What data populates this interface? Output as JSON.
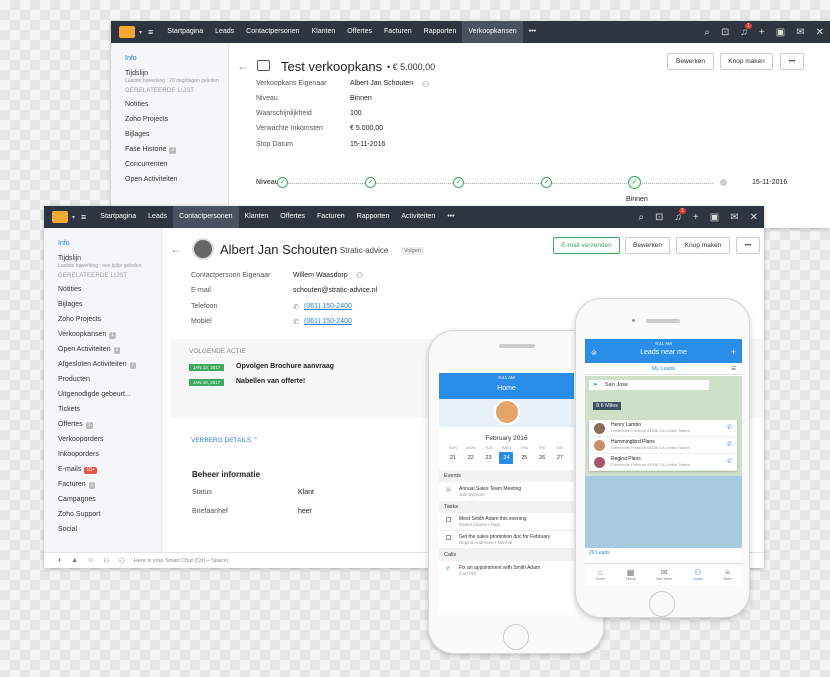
{
  "back_window": {
    "nav": [
      "Startpagina",
      "Leads",
      "Contactpersonen",
      "Klanten",
      "Offertes",
      "Facturen",
      "Rapporten",
      "Verkoopkansen"
    ],
    "active": "Verkoopkansen",
    "more": "•••",
    "sidebar": {
      "info": "Info",
      "tijdslijn": "Tijdslijn",
      "tijdslijn_sub": "Laatste bijwerking : 20 dag/dagen geleden",
      "related_header": "GERELATEERDE LIJST",
      "items": [
        {
          "label": "Notities",
          "count": ""
        },
        {
          "label": "Zoho Projects",
          "count": ""
        },
        {
          "label": "Bijlages",
          "count": ""
        },
        {
          "label": "Fase Historie",
          "count": "3"
        },
        {
          "label": "Concurrenten",
          "count": ""
        },
        {
          "label": "Open Activiteiten",
          "count": ""
        }
      ]
    },
    "title": "Test verkoopkans",
    "amount": "• € 5.000,00",
    "buttons": {
      "edit": "Bewerken",
      "make": "Knop maken",
      "more": "•••"
    },
    "fields": [
      {
        "label": "Verkoopkans Eigenaar",
        "value": "Albert Jan Schouten"
      },
      {
        "label": "Niveau",
        "value": "Binnen"
      },
      {
        "label": "Waarschijnlijkheid",
        "value": "100"
      },
      {
        "label": "Verwachte Inkomsten",
        "value": "€ 5.000,00"
      },
      {
        "label": "Stop Datum",
        "value": "15-11-2016"
      }
    ],
    "stage_label": "Niveau",
    "stage_date": "15-11-2016",
    "stage_current": "Binnen"
  },
  "front_window": {
    "nav": [
      "Startpagina",
      "Leads",
      "Contactpersonen",
      "Klanten",
      "Offertes",
      "Facturen",
      "Rapporten",
      "Activiteiten"
    ],
    "active": "Contactpersonen",
    "more": "•••",
    "sidebar": {
      "info": "Info",
      "tijdslijn": "Tijdslijn",
      "tijdslijn_sub": "Laatste bijwerking : een tijdje geleden",
      "related_header": "GERELATEERDE LIJST",
      "items": [
        {
          "label": "Notities",
          "count": ""
        },
        {
          "label": "Bijlages",
          "count": ""
        },
        {
          "label": "Zoho Projects",
          "count": ""
        },
        {
          "label": "Verkoopkansen",
          "count": "1"
        },
        {
          "label": "Open Activiteiten",
          "count": "2"
        },
        {
          "label": "Afgesloten Activiteiten",
          "count": "7"
        },
        {
          "label": "Producten",
          "count": ""
        },
        {
          "label": "Uitgenodigde gebeurt...",
          "count": ""
        },
        {
          "label": "Tickets",
          "count": ""
        },
        {
          "label": "Offertes",
          "count": "1"
        },
        {
          "label": "Verkooporders",
          "count": ""
        },
        {
          "label": "Inkooporders",
          "count": ""
        },
        {
          "label": "E-mails",
          "count": "10+",
          "red": true
        },
        {
          "label": "Facturen",
          "count": "1"
        },
        {
          "label": "Campagnes",
          "count": ""
        },
        {
          "label": "Zoho Support",
          "count": ""
        },
        {
          "label": "Social",
          "count": ""
        }
      ]
    },
    "name": "Albert Jan Schouten",
    "company": "- Stratic-advice",
    "follow": "Volgen",
    "buttons": {
      "email": "E-mail verzenden",
      "edit": "Bewerken",
      "make": "Knop maken",
      "more": "•••"
    },
    "fields": [
      {
        "label": "Contactpersoon Eigenaar",
        "value": "Willem Waasdorp"
      },
      {
        "label": "E-mail",
        "value": "schouten@stratic-advice.nl"
      },
      {
        "label": "Telefoon",
        "value": "(061) 150-2400"
      },
      {
        "label": "Mobiel",
        "value": "(061) 150-2400"
      }
    ],
    "next_action_header": "VOLGENDE ACTIE",
    "actions": [
      {
        "date": "JAN 12, 2017",
        "text": "Opvolgen Brochure aanvraag"
      },
      {
        "date": "JAN 28, 2017",
        "text": "Nabellen van offerte!"
      }
    ],
    "hide_details": "VERBERG DETAILS",
    "mgmt_header": "Beheer informatie",
    "mgmt": [
      {
        "label": "Status",
        "value": "Klant"
      },
      {
        "label": "Briefaanhef",
        "value": "heer"
      }
    ],
    "chat_placeholder": "Here is your Smart Chat (Ctrl + Space)"
  },
  "phone_left": {
    "time": "9:41 AM",
    "title": "Home",
    "month": "February 2016",
    "days": [
      "SUN",
      "MON",
      "TUE",
      "WED",
      "THU",
      "FRI",
      "SAT"
    ],
    "dates": [
      "21",
      "22",
      "23",
      "24",
      "25",
      "26",
      "27"
    ],
    "selected": "24",
    "events_header": "Events",
    "event": "Annual Sales Team Meeting",
    "event_sub": "Sub Sysnore",
    "tasks_header": "Tasks",
    "tasks": [
      {
        "text": "Meet Smith Adam this evening",
        "sub": "Daniel Adams • High"
      },
      {
        "text": "Get the sales promotion doc for February",
        "sub": "Regina Andersen • Normal"
      }
    ],
    "calls_header": "Calls",
    "call": "Fix an appointment with Smith Adam",
    "call_time": "2:10 PM"
  },
  "phone_right": {
    "time": "9:41 AM",
    "title": "Leads near me",
    "filter": "My Leads",
    "location": "San Jose",
    "distance": "8.6 Miles",
    "leads": [
      {
        "name": "Henry Lambo",
        "addr": "Centerville Fremont 94536 CA United States"
      },
      {
        "name": "Hummingbird Plans",
        "addr": "Centerville Fremont 94536 CA United States"
      },
      {
        "name": "Regina Plans",
        "addr": "Centerville Fremont 94536 CA United States"
      }
    ],
    "count": "20 Leads",
    "tabs": [
      "Home",
      "Feeds",
      "Mail Inbox",
      "Leads",
      "More"
    ],
    "active_tab": "Leads"
  },
  "colors": {
    "nav": "#2e3440",
    "accent": "#2f7bd5",
    "green": "#3fa95d",
    "mobile_blue": "#2a8ee8"
  }
}
